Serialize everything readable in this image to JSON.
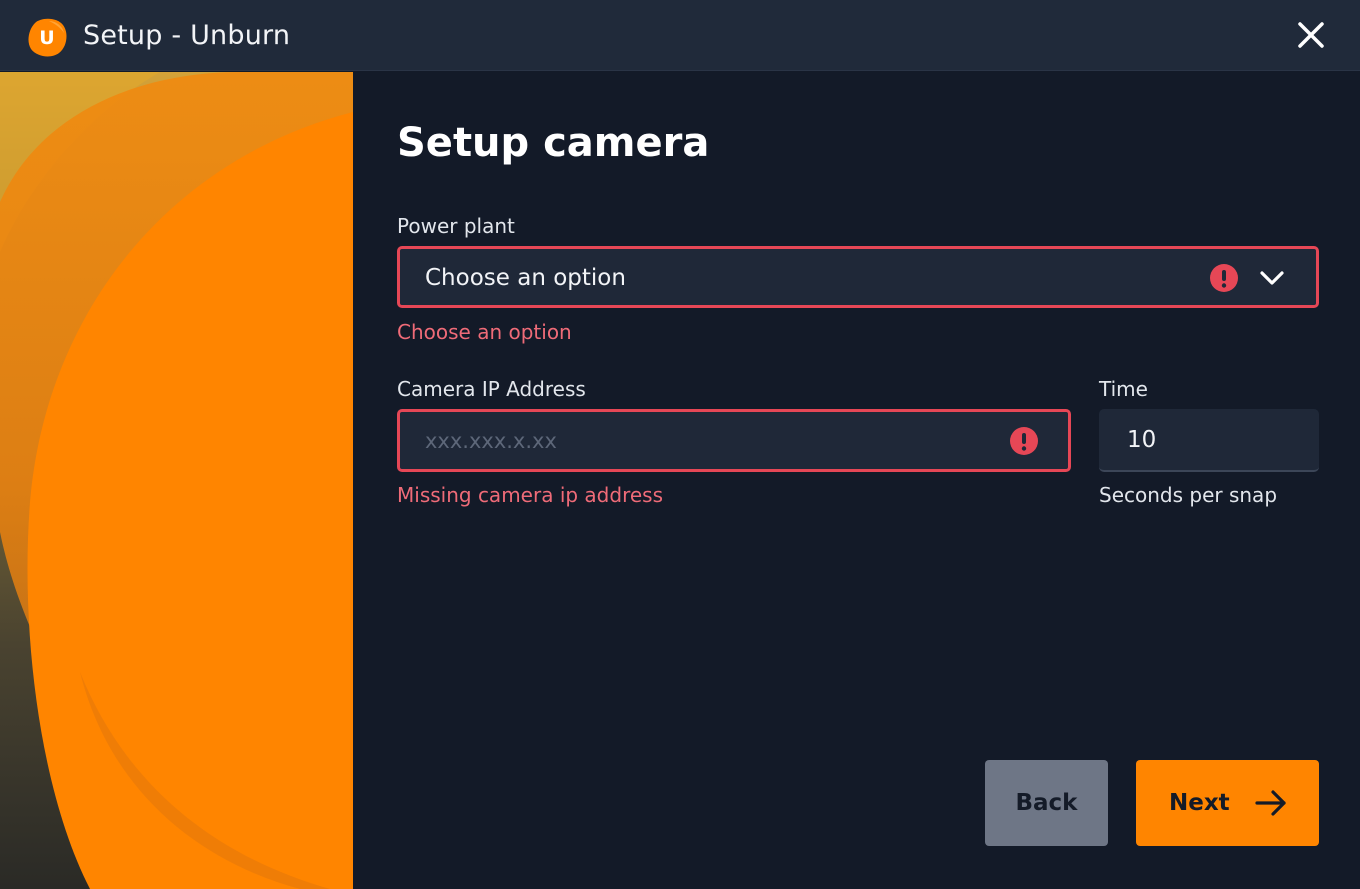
{
  "window": {
    "title": "Setup - Unburn",
    "logo_letter": "U",
    "logo_icon": "unburn-logo-icon",
    "close_icon": "close-icon"
  },
  "main": {
    "title": "Setup camera",
    "power_plant": {
      "label": "Power plant",
      "selected_value": "Choose an option",
      "error": "Choose an option",
      "error_icon": "exclamation-circle-icon",
      "dropdown_icon": "chevron-down-icon"
    },
    "camera_ip": {
      "label": "Camera IP Address",
      "value": "",
      "placeholder": "xxx.xxx.x.xx",
      "error": "Missing camera ip address",
      "error_icon": "exclamation-circle-icon"
    },
    "time": {
      "label": "Time",
      "value": "10",
      "helper": "Seconds per snap"
    },
    "buttons": {
      "back_label": "Back",
      "next_label": "Next",
      "next_icon": "arrow-right-icon"
    }
  },
  "colors": {
    "background": "#131a28",
    "titlebar": "#202a3a",
    "field_background": "#1f2838",
    "error": "#e64756",
    "error_text": "#ef6b78",
    "accent": "#ff8500",
    "back_button": "#6e7686"
  }
}
